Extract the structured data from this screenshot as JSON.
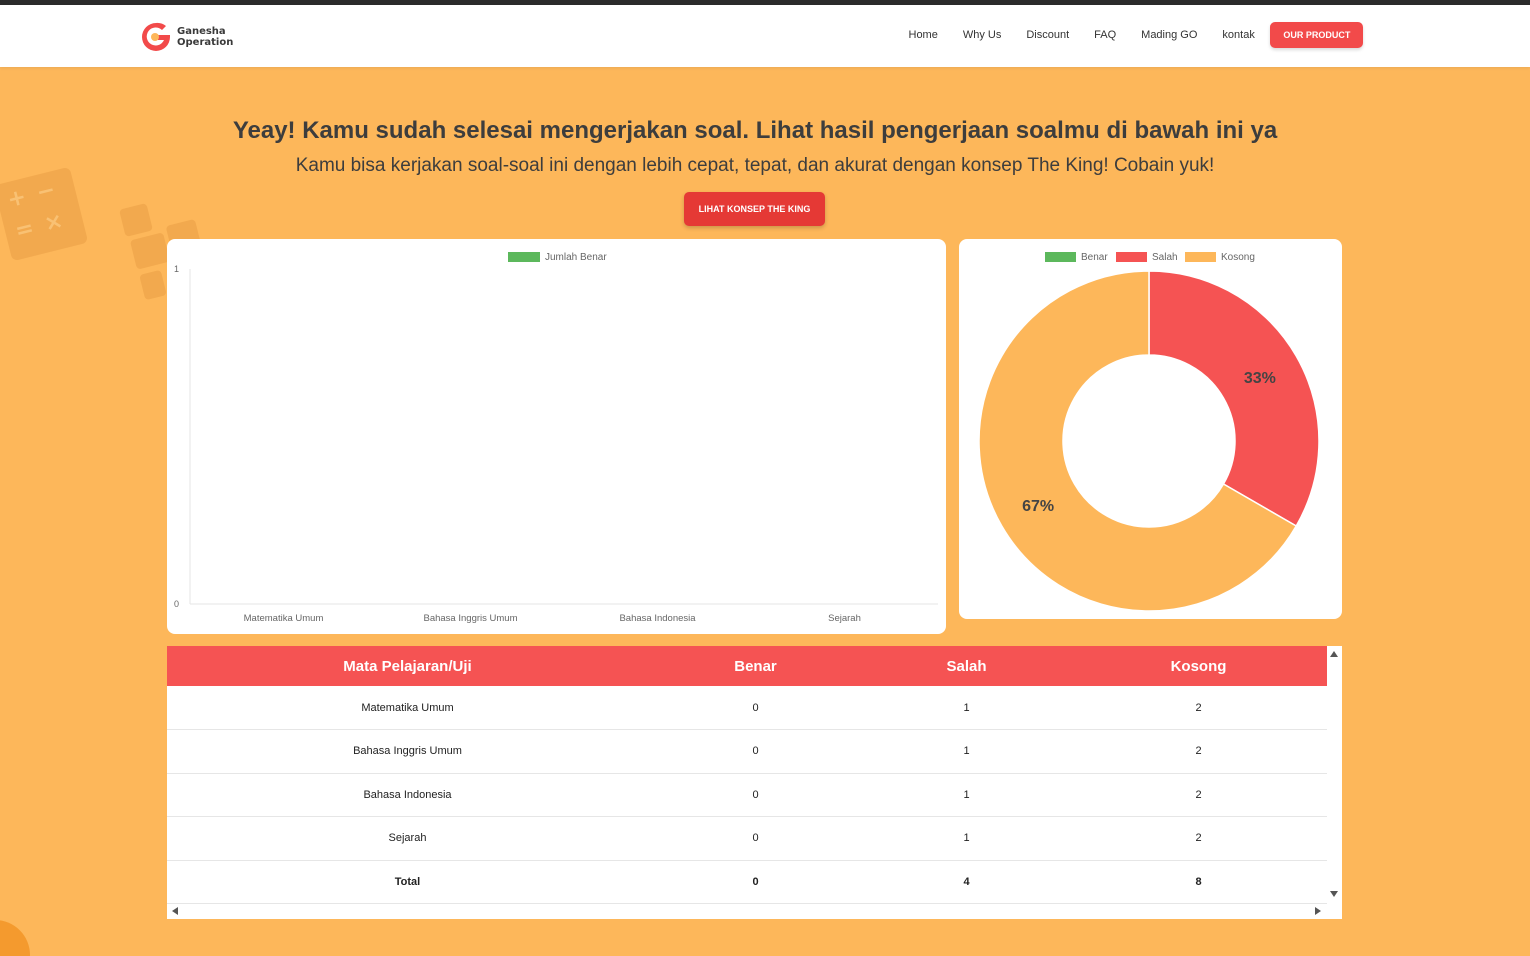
{
  "brand": {
    "name_line1": "Ganesha",
    "name_line2": "Operation",
    "accent": "#f24a4a"
  },
  "nav": {
    "links": [
      "Home",
      "Why Us",
      "Discount",
      "FAQ",
      "Mading GO",
      "kontak"
    ],
    "product_button": "OUR PRODUCT"
  },
  "hero": {
    "title": "Yeay! Kamu sudah selesai mengerjakan soal. Lihat hasil pengerjaan soalmu di bawah ini ya",
    "subtitle": "Kamu bisa kerjakan soal-soal ini dengan lebih cepat, tepat, dan akurat dengan konsep The King! Cobain yuk!",
    "cta_label": "LIHAT KONSEP THE KING"
  },
  "chart_data": [
    {
      "type": "bar",
      "categories": [
        "Matematika Umum",
        "Bahasa Inggris Umum",
        "Bahasa Indonesia",
        "Sejarah"
      ],
      "series": [
        {
          "name": "Jumlah Benar",
          "values": [
            0,
            0,
            0,
            0
          ],
          "color": "#5cb85c"
        }
      ],
      "ylim": [
        0,
        1
      ],
      "yticks": [
        "0",
        "1"
      ],
      "legend": "top"
    },
    {
      "type": "pie",
      "style": "doughnut",
      "labels": [
        "Benar",
        "Salah",
        "Kosong"
      ],
      "values": [
        0,
        4,
        8
      ],
      "percent_labels": [
        "",
        "33%",
        "67%"
      ],
      "colors": [
        "#5cb85c",
        "#f55353",
        "#fdb75a"
      ],
      "legend": "top"
    }
  ],
  "table": {
    "headers": [
      "Mata Pelajaran/Uji",
      "Benar",
      "Salah",
      "Kosong"
    ],
    "rows": [
      [
        "Matematika Umum",
        "0",
        "1",
        "2"
      ],
      [
        "Bahasa Inggris Umum",
        "0",
        "1",
        "2"
      ],
      [
        "Bahasa Indonesia",
        "0",
        "1",
        "2"
      ],
      [
        "Sejarah",
        "0",
        "1",
        "2"
      ]
    ],
    "total": [
      "Total",
      "0",
      "4",
      "8"
    ]
  }
}
